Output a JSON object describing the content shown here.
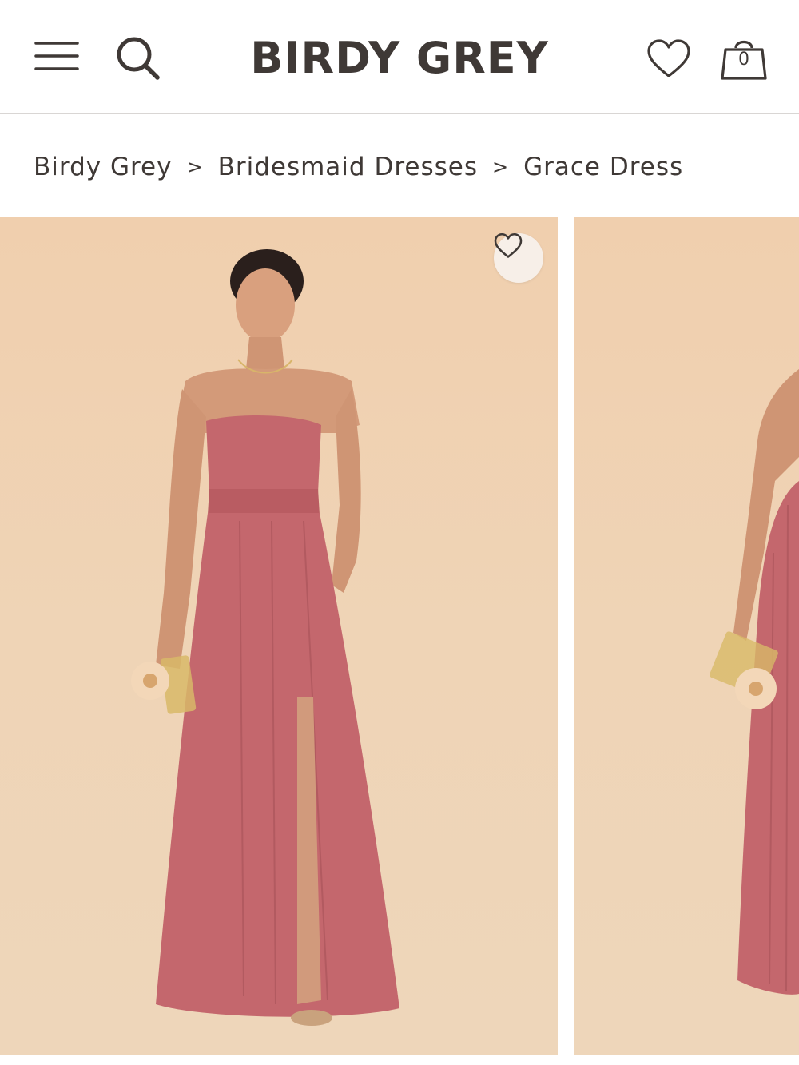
{
  "header": {
    "logo": "BIRDY GREY",
    "bag_count": "0",
    "icons": {
      "menu": "hamburger-menu-icon",
      "search": "search-icon",
      "wishlist": "heart-icon",
      "bag": "shopping-bag-icon"
    }
  },
  "breadcrumb": {
    "items": [
      "Birdy Grey",
      "Bridesmaid Dresses",
      "Grace Dress"
    ],
    "separator": ">"
  },
  "gallery": {
    "favorite_icon": "heart-icon",
    "colors": {
      "backdrop": "#efd2b4",
      "dress": "#c4676d"
    }
  }
}
